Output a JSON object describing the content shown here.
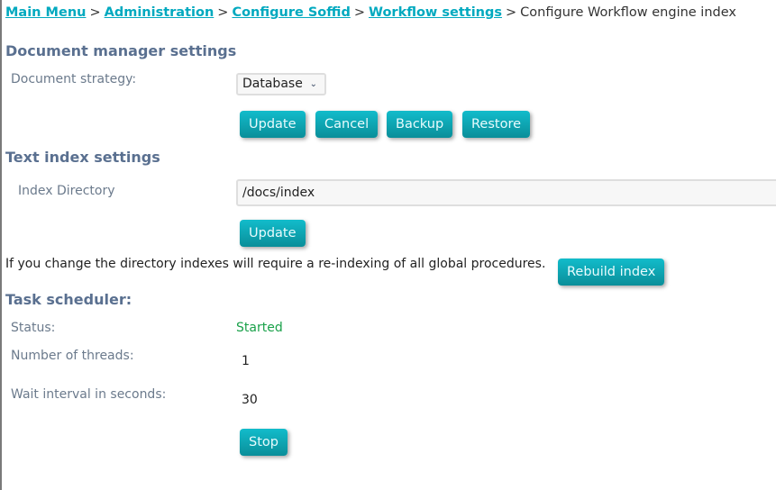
{
  "breadcrumb": {
    "items": [
      {
        "label": "Main Menu",
        "link": true
      },
      {
        "label": "Administration",
        "link": true
      },
      {
        "label": "Configure Soffid",
        "link": true
      },
      {
        "label": "Workflow settings",
        "link": true
      },
      {
        "label": "Configure Workflow engine index",
        "link": false
      }
    ],
    "separator": ">"
  },
  "document_manager": {
    "heading": "Document manager settings",
    "strategy_label": "Document strategy:",
    "strategy_value": "Database",
    "buttons": {
      "update": "Update",
      "cancel": "Cancel",
      "backup": "Backup",
      "restore": "Restore"
    }
  },
  "text_index": {
    "heading": "Text index settings",
    "directory_label": "Index Directory",
    "directory_value": "/docs/index",
    "update_button": "Update",
    "message": "If you change the directory indexes will require a re-indexing of all global procedures.",
    "rebuild_button": "Rebuild index"
  },
  "task_scheduler": {
    "heading": "Task scheduler:",
    "status_label": "Status:",
    "status_value": "Started",
    "threads_label": "Number of threads:",
    "threads_value": "1",
    "wait_label": "Wait interval in seconds:",
    "wait_value": "30",
    "stop_button": "Stop"
  },
  "colors": {
    "link": "#00a9bf",
    "button": "#0a9fac",
    "heading": "#5a7090",
    "status_ok": "#1aa14a"
  }
}
